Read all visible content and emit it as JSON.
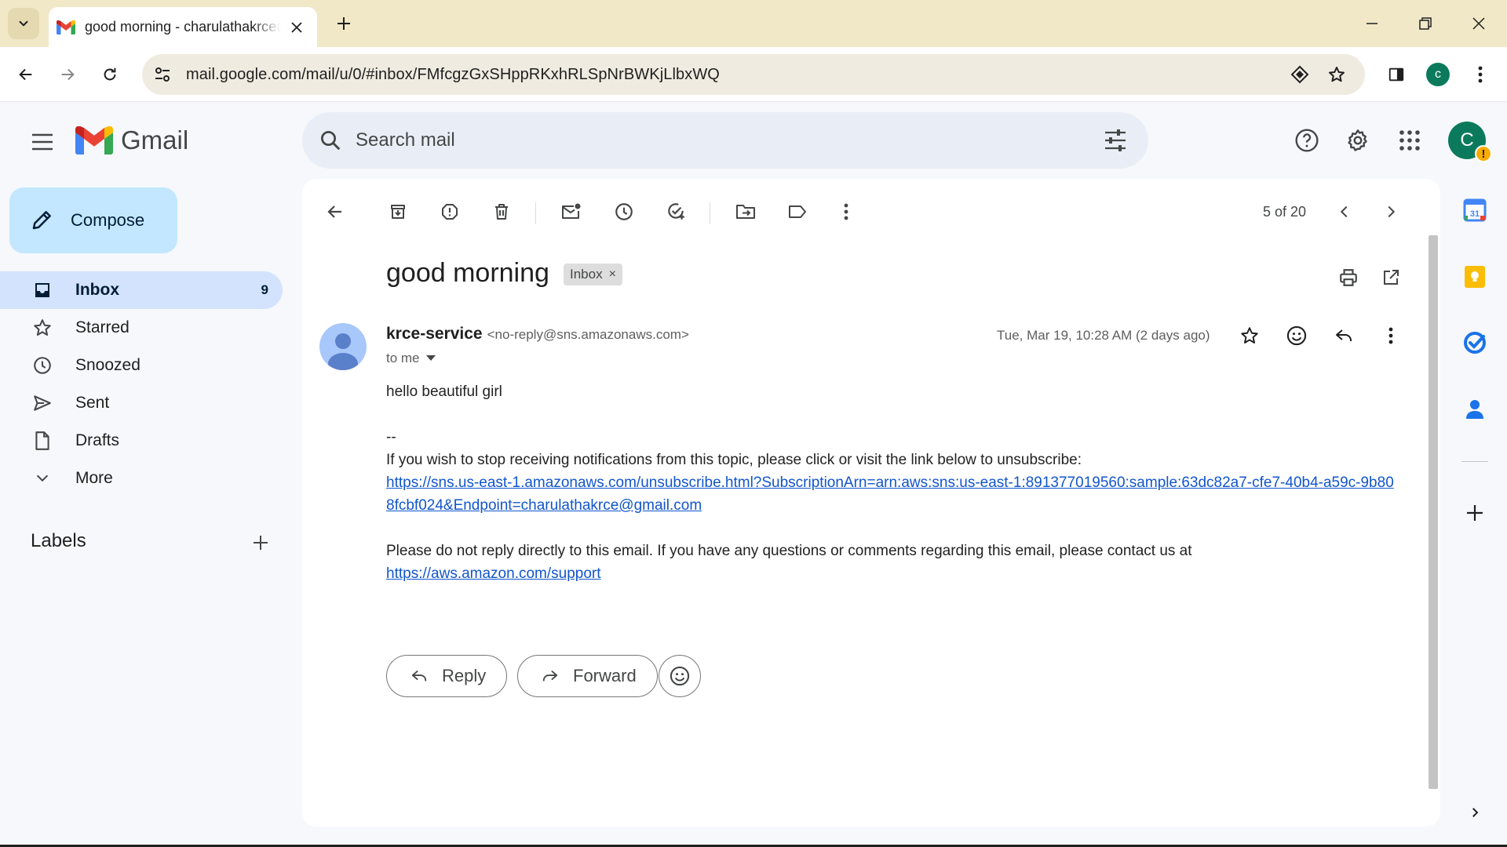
{
  "browser": {
    "tab_title": "good morning - charulathakrce@gmail.com",
    "url": "mail.google.com/mail/u/0/#inbox/FMfcgzGxSHppRKxhRLSpNrBWKjLlbxWQ",
    "profile_initial": "c"
  },
  "gmail": {
    "wordmark": "Gmail",
    "search_placeholder": "Search mail",
    "account_initial": "C",
    "account_warning": "!"
  },
  "sidebar": {
    "compose_label": "Compose",
    "items": [
      {
        "label": "Inbox",
        "count": "9",
        "icon": "inbox-icon"
      },
      {
        "label": "Starred",
        "icon": "star-icon"
      },
      {
        "label": "Snoozed",
        "icon": "clock-icon"
      },
      {
        "label": "Sent",
        "icon": "send-icon"
      },
      {
        "label": "Drafts",
        "icon": "draft-icon"
      },
      {
        "label": "More",
        "icon": "chevron-down-icon"
      }
    ],
    "labels_heading": "Labels"
  },
  "toolbar": {
    "pager": "5 of 20"
  },
  "message": {
    "subject": "good morning",
    "label_chip": "Inbox",
    "label_chip_close": "×",
    "sender_name": "krce-service",
    "sender_email": "<no-reply@sns.amazonaws.com>",
    "to": "to me",
    "date": "Tue, Mar 19, 10:28 AM (2 days ago)",
    "body": {
      "greeting": "hello beautiful girl",
      "signature_sep": "--",
      "unsubscribe_text": "If you wish to stop receiving notifications from this topic, please click or visit the link below to unsubscribe:",
      "unsubscribe_link": "https://sns.us-east-1.amazonaws.com/unsubscribe.html?SubscriptionArn=arn:aws:sns:us-east-1:891377019560:sample:63dc82a7-cfe7-40b4-a59c-9b808fcbf024&Endpoint=charulathakrce@gmail.com",
      "contact_text": "Please do not reply directly to this email. If you have any questions or comments regarding this email, please contact us at",
      "support_link": "https://aws.amazon.com/support"
    },
    "reply_label": "Reply",
    "forward_label": "Forward"
  },
  "colors": {
    "compose_bg": "#c2e7ff",
    "active_nav_bg": "#d3e3fd",
    "link": "#1155cc",
    "avatar_green": "#0b7a5c"
  }
}
